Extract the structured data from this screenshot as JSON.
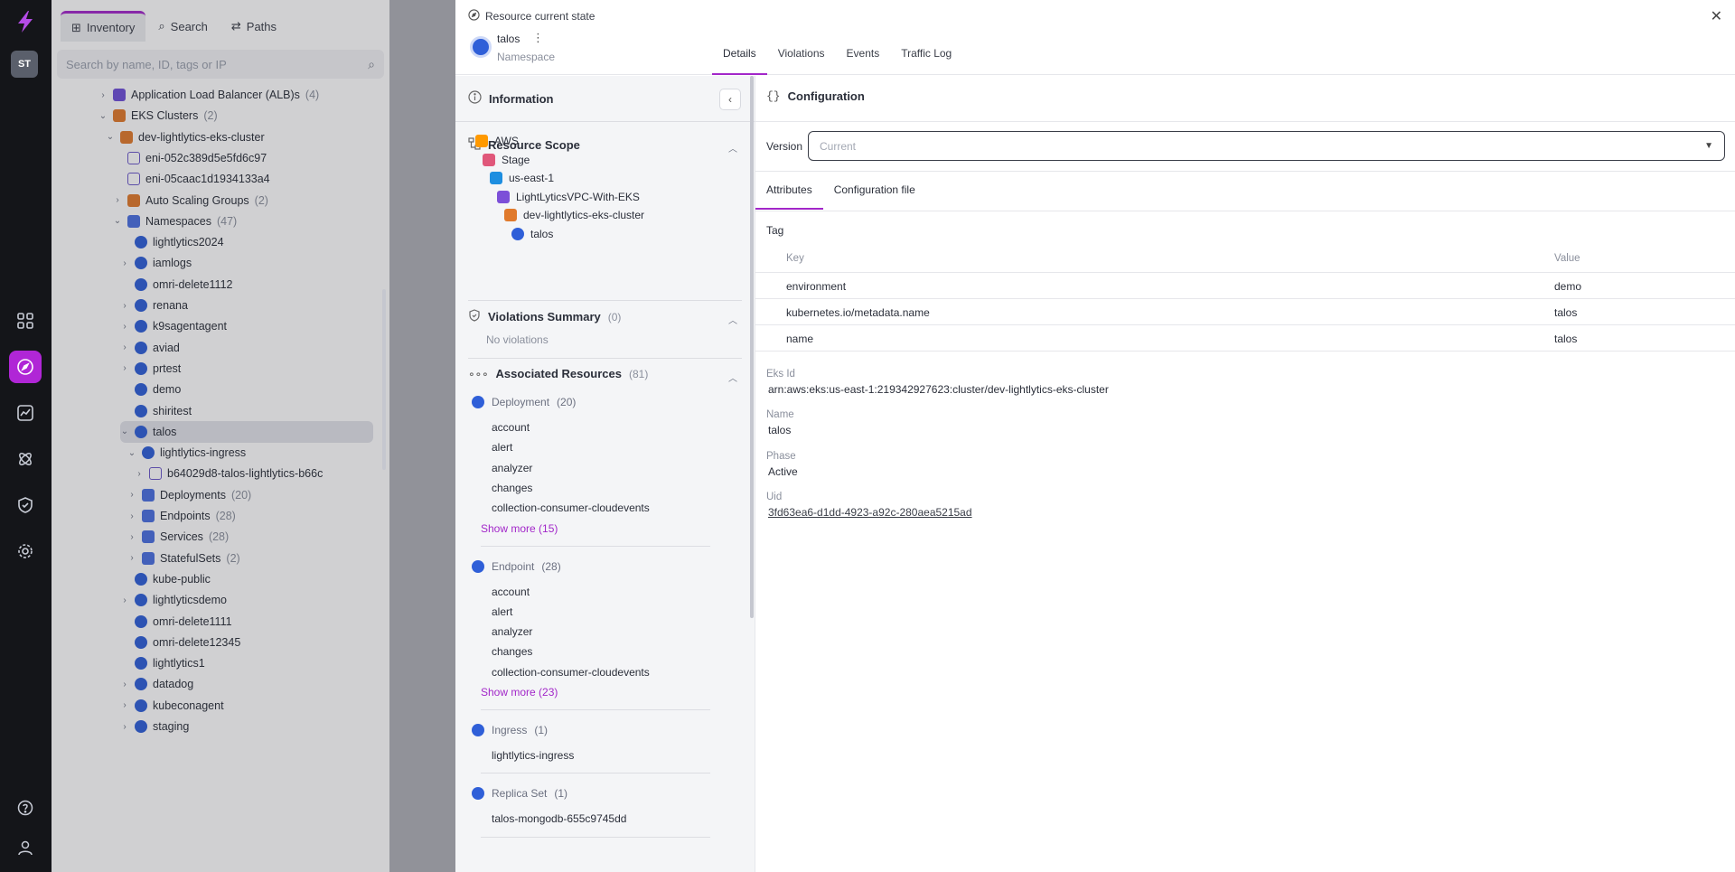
{
  "rail": {
    "avatar_initials": "ST",
    "nav_icons": [
      "grid-icon",
      "compass-icon",
      "chart-icon",
      "atom-icon",
      "shield-icon",
      "gear-icon"
    ],
    "bottom_icons": [
      "help-icon",
      "user-icon"
    ],
    "accent": "#b026d6"
  },
  "inventory": {
    "tabs": [
      {
        "label": "Inventory",
        "icon": "inventory-icon",
        "active": true
      },
      {
        "label": "Search",
        "icon": "search-icon",
        "active": false
      },
      {
        "label": "Paths",
        "icon": "paths-icon",
        "active": false
      }
    ],
    "search_placeholder": "Search by name, ID, tags or IP",
    "tree": [
      {
        "label": "Application Load Balancer (ALB)s",
        "count": "(4)",
        "depth": 0,
        "chev": "›",
        "icon": "sq"
      },
      {
        "label": "EKS Clusters",
        "count": "(2)",
        "depth": 0,
        "chev": "⌄",
        "icon": "org"
      },
      {
        "label": "dev-lightlytics-eks-cluster",
        "count": "",
        "depth": 1,
        "chev": "⌄",
        "icon": "org"
      },
      {
        "label": "eni-052c389d5e5fd6c97",
        "count": "",
        "depth": 2,
        "chev": "",
        "icon": "eni"
      },
      {
        "label": "eni-05caac1d1934133a4",
        "count": "",
        "depth": 2,
        "chev": "",
        "icon": "eni"
      },
      {
        "label": "Auto Scaling Groups",
        "count": "(2)",
        "depth": 2,
        "chev": "›",
        "icon": "org"
      },
      {
        "label": "Namespaces",
        "count": "(47)",
        "depth": 2,
        "chev": "⌄",
        "icon": "grid"
      },
      {
        "label": "lightlytics2024",
        "count": "",
        "depth": 3,
        "chev": "",
        "icon": "ns"
      },
      {
        "label": "iamlogs",
        "count": "",
        "depth": 3,
        "chev": "›",
        "icon": "ns"
      },
      {
        "label": "omri-delete1112",
        "count": "",
        "depth": 3,
        "chev": "",
        "icon": "ns"
      },
      {
        "label": "renana",
        "count": "",
        "depth": 3,
        "chev": "›",
        "icon": "ns"
      },
      {
        "label": "k9sagentagent",
        "count": "",
        "depth": 3,
        "chev": "›",
        "icon": "ns"
      },
      {
        "label": "aviad",
        "count": "",
        "depth": 3,
        "chev": "›",
        "icon": "ns"
      },
      {
        "label": "prtest",
        "count": "",
        "depth": 3,
        "chev": "›",
        "icon": "ns"
      },
      {
        "label": "demo",
        "count": "",
        "depth": 3,
        "chev": "",
        "icon": "ns"
      },
      {
        "label": "shiritest",
        "count": "",
        "depth": 3,
        "chev": "",
        "icon": "ns"
      },
      {
        "label": "talos",
        "count": "",
        "depth": 3,
        "chev": "⌄",
        "icon": "ns",
        "selected": true
      },
      {
        "label": "lightlytics-ingress",
        "count": "",
        "depth": 4,
        "chev": "⌄",
        "icon": "ns"
      },
      {
        "label": "b64029d8-talos-lightlytics-b66c",
        "count": "",
        "depth": 5,
        "chev": "›",
        "icon": "eni"
      },
      {
        "label": "Deployments",
        "count": "(20)",
        "depth": 4,
        "chev": "›",
        "icon": "grid"
      },
      {
        "label": "Endpoints",
        "count": "(28)",
        "depth": 4,
        "chev": "›",
        "icon": "grid"
      },
      {
        "label": "Services",
        "count": "(28)",
        "depth": 4,
        "chev": "›",
        "icon": "grid"
      },
      {
        "label": "StatefulSets",
        "count": "(2)",
        "depth": 4,
        "chev": "›",
        "icon": "grid"
      },
      {
        "label": "kube-public",
        "count": "",
        "depth": 3,
        "chev": "",
        "icon": "ns"
      },
      {
        "label": "lightlyticsdemo",
        "count": "",
        "depth": 3,
        "chev": "›",
        "icon": "ns"
      },
      {
        "label": "omri-delete1111",
        "count": "",
        "depth": 3,
        "chev": "",
        "icon": "ns"
      },
      {
        "label": "omri-delete12345",
        "count": "",
        "depth": 3,
        "chev": "",
        "icon": "ns"
      },
      {
        "label": "lightlytics1",
        "count": "",
        "depth": 3,
        "chev": "",
        "icon": "ns"
      },
      {
        "label": "datadog",
        "count": "",
        "depth": 3,
        "chev": "›",
        "icon": "ns"
      },
      {
        "label": "kubeconagent",
        "count": "",
        "depth": 3,
        "chev": "›",
        "icon": "ns"
      },
      {
        "label": "staging",
        "count": "",
        "depth": 3,
        "chev": "›",
        "icon": "ns"
      }
    ]
  },
  "drawer": {
    "state_label": "Resource current state",
    "resource_name": "talos",
    "resource_type": "Namespace",
    "tabs": [
      "Details",
      "Violations",
      "Events",
      "Traffic Log"
    ],
    "info": {
      "title": "Information",
      "scope_title": "Resource Scope",
      "scope": [
        {
          "label": "AWS",
          "indent": 0,
          "color": "#f90"
        },
        {
          "label": "Stage",
          "indent": 1,
          "color": "#e0577a"
        },
        {
          "label": "us-east-1",
          "indent": 2,
          "color": "#1d8ee0"
        },
        {
          "label": "LightLyticsVPC-With-EKS",
          "indent": 3,
          "color": "#7c4fd8"
        },
        {
          "label": "dev-lightlytics-eks-cluster",
          "indent": 4,
          "color": "#e07a2c"
        },
        {
          "label": "talos",
          "indent": 5,
          "color": "#2f5fd8"
        }
      ],
      "violations_title": "Violations Summary",
      "violations_count": "(0)",
      "no_violations": "No violations",
      "assoc_title": "Associated Resources",
      "assoc_count": "(81)",
      "groups": [
        {
          "name": "Deployment",
          "count": "(20)",
          "items": [
            "account",
            "alert",
            "analyzer",
            "changes",
            "collection-consumer-cloudevents"
          ],
          "more": "Show more (15)"
        },
        {
          "name": "Endpoint",
          "count": "(28)",
          "items": [
            "account",
            "alert",
            "analyzer",
            "changes",
            "collection-consumer-cloudevents"
          ],
          "more": "Show more (23)"
        },
        {
          "name": "Ingress",
          "count": "(1)",
          "items": [
            "lightlytics-ingress"
          ],
          "more": ""
        },
        {
          "name": "Replica Set",
          "count": "(1)",
          "items": [
            "talos-mongodb-655c9745dd"
          ],
          "more": ""
        }
      ]
    },
    "config": {
      "title": "Configuration",
      "version_label": "Version",
      "version_placeholder": "Current",
      "tabs": [
        "Attributes",
        "Configuration file"
      ],
      "tag_label": "Tag",
      "key_header": "Key",
      "value_header": "Value",
      "tags": [
        {
          "key": "environment",
          "value": "demo"
        },
        {
          "key": "kubernetes.io/metadata.name",
          "value": "talos"
        },
        {
          "key": "name",
          "value": "talos"
        }
      ],
      "fields": [
        {
          "label": "Eks Id",
          "value": "arn:aws:eks:us-east-1:219342927623:cluster/dev-lightlytics-eks-cluster"
        },
        {
          "label": "Name",
          "value": "talos"
        },
        {
          "label": "Phase",
          "value": "Active"
        },
        {
          "label": "Uid",
          "value": "3fd63ea6-d1dd-4923-a92c-280aea5215ad"
        }
      ]
    }
  }
}
